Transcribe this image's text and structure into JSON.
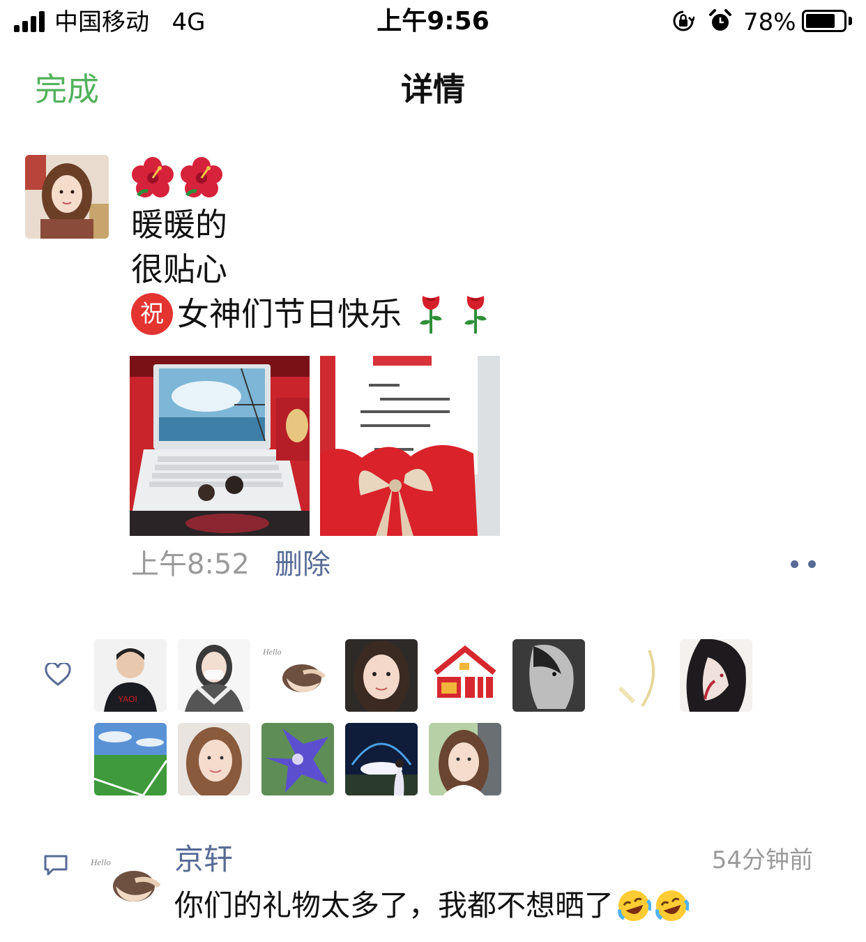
{
  "status_bar": {
    "carrier": "中国移动",
    "network": "4G",
    "time": "上午9:56",
    "battery_percent": "78%",
    "battery_level": 0.78
  },
  "nav": {
    "done_label": "完成",
    "title": "详情"
  },
  "post": {
    "line1": "暖暖的",
    "line2": "很贴心",
    "blessing_glyph": "祝",
    "line3": "女神们节日快乐",
    "time": "上午8:52",
    "delete_label": "删除",
    "icons": [
      "hibiscus-icon",
      "hibiscus-icon",
      "congratulate-icon",
      "rose-icon",
      "rose-icon"
    ],
    "photos": [
      "laptop-photo",
      "card-photo"
    ]
  },
  "likes": {
    "icon": "heart-icon",
    "avatars": [
      "avatar-1",
      "avatar-2",
      "avatar-3",
      "avatar-4",
      "avatar-5",
      "avatar-6",
      "avatar-7",
      "avatar-8",
      "avatar-9",
      "avatar-10",
      "avatar-11",
      "avatar-12",
      "avatar-13"
    ]
  },
  "comment": {
    "icon": "comment-icon",
    "author": "京轩",
    "time": "54分钟前",
    "text": "你们的礼物太多了，我都不想晒了",
    "emoji": [
      "laughing-crying-icon",
      "laughing-crying-icon"
    ]
  },
  "colors": {
    "accent_green": "#53b25c",
    "link_blue": "#576b95",
    "muted_gray": "#9a9a9a"
  }
}
